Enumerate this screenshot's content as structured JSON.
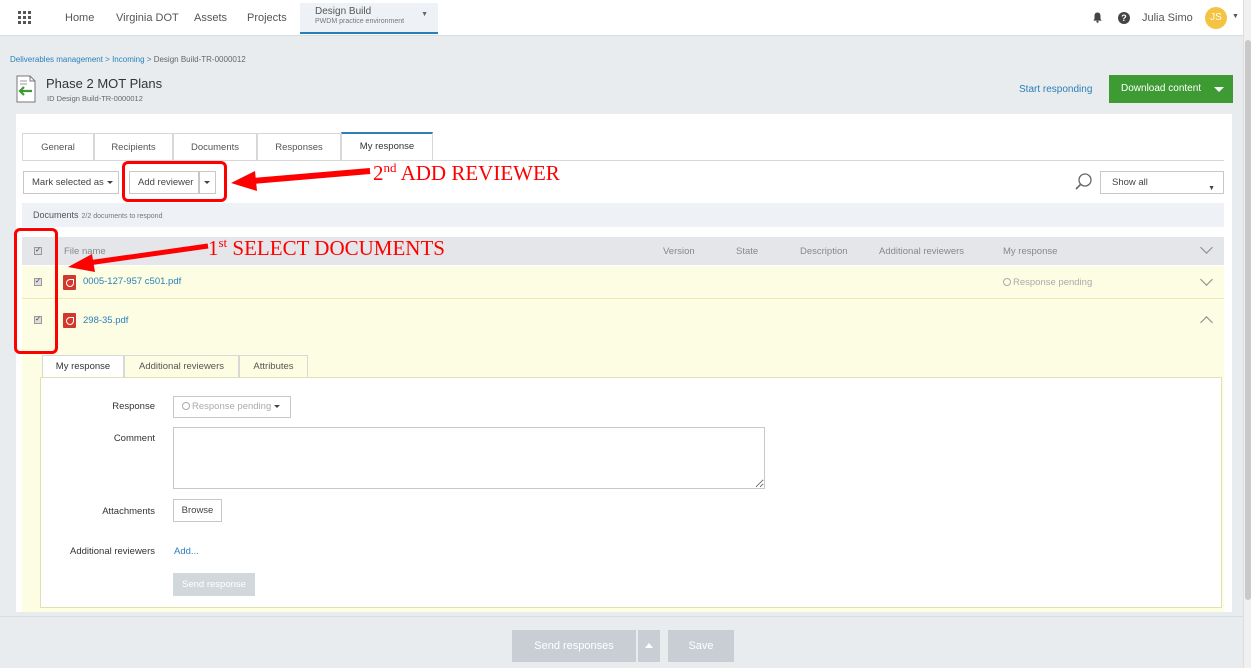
{
  "nav": {
    "items": [
      "Home",
      "Virginia DOT",
      "Assets",
      "Projects"
    ],
    "context_title": "Design Build",
    "context_subtitle": "PWDM practice environment",
    "user_name": "Julia Simo",
    "user_initials": "JS"
  },
  "breadcrumb": {
    "items": [
      "Deliverables management",
      "Incoming"
    ],
    "separator": ">",
    "current": "Design Build-TR-0000012"
  },
  "header": {
    "title": "Phase 2 MOT Plans",
    "id_label": "ID Design Build-TR-0000012",
    "start_responding": "Start responding",
    "download": "Download content"
  },
  "tabs": [
    "General",
    "Recipients",
    "Documents",
    "Responses",
    "My response"
  ],
  "active_tab": "My response",
  "toolbar": {
    "mark_selected": "Mark selected as",
    "add_reviewer": "Add reviewer",
    "filter_value": "Show all"
  },
  "documents_bar": {
    "label": "Documents",
    "count": "2/2 documents to respond"
  },
  "table": {
    "columns": [
      "File name",
      "Version",
      "State",
      "Description",
      "Additional reviewers",
      "My response"
    ],
    "rows": [
      {
        "file": "0005-127-957 c501.pdf",
        "checked": true,
        "my_response": "Response pending",
        "expanded": false
      },
      {
        "file": "298-35.pdf",
        "checked": true,
        "my_response": "",
        "expanded": true
      }
    ]
  },
  "detail": {
    "tabs": [
      "My response",
      "Additional reviewers",
      "Attributes"
    ],
    "response_label": "Response",
    "response_value": "Response pending",
    "comment_label": "Comment",
    "attachments_label": "Attachments",
    "browse": "Browse",
    "additional_reviewers_label": "Additional reviewers",
    "add_link": "Add...",
    "send_response": "Send response"
  },
  "footer": {
    "send_responses": "Send responses",
    "save": "Save"
  },
  "annotations": {
    "step1_num": "1",
    "step1_sup": "st",
    "step1_text": " SELECT DOCUMENTS",
    "step2_num": "2",
    "step2_sup": "nd",
    "step2_text": " ADD REVIEWER",
    "color": "#ff0000"
  },
  "colors": {
    "accent": "#2a7fb8",
    "download_green": "#3e9b34",
    "row_highlight": "#fdfde3",
    "pdf_red": "#d2382b"
  }
}
